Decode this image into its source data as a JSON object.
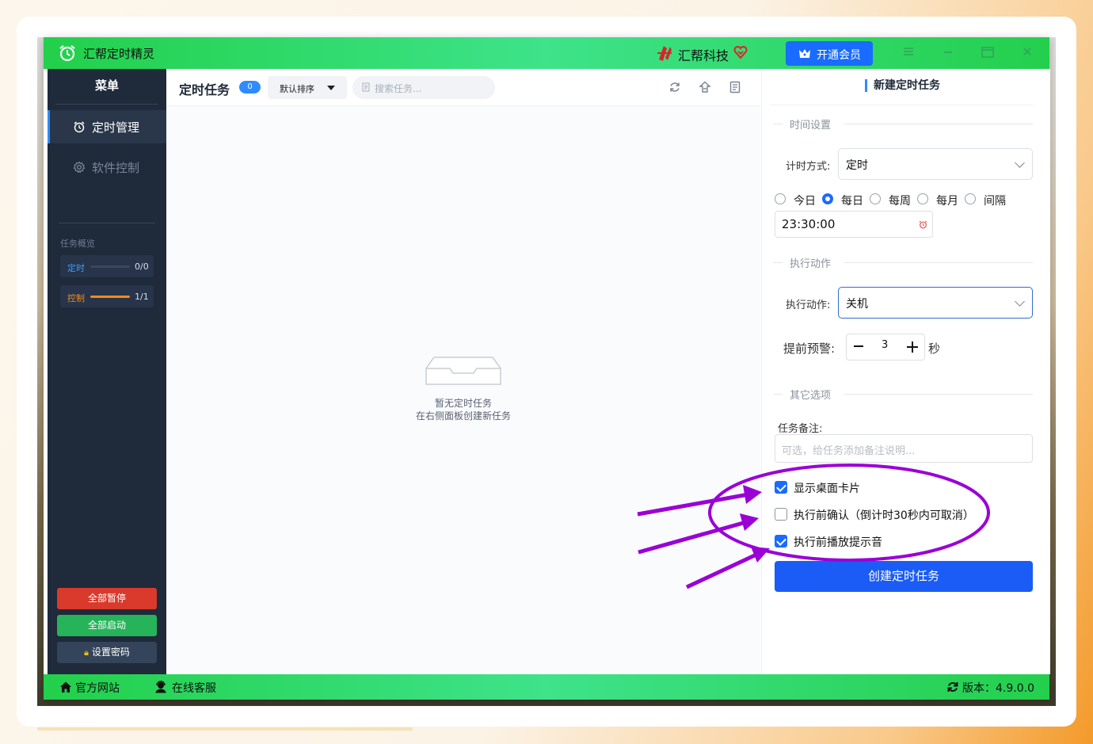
{
  "colors": {
    "titlebar_green": "#2ed760",
    "sidebar_bg": "#1f2a3a",
    "accent_blue": "#1a6bff",
    "pause_red": "#d93a2b",
    "start_green": "#27b35a",
    "annotation_purple": "#9a00d6"
  },
  "titlebar": {
    "app_title": "汇帮定时精灵",
    "brand": "汇帮科技",
    "vip_label": "开通会员",
    "icons": [
      "clock-logo-icon",
      "brand-logo-icon",
      "heart-icon",
      "crown-icon",
      "menu-icon",
      "minimize-icon",
      "maximize-icon",
      "close-icon"
    ]
  },
  "sidebar": {
    "menu_title": "菜单",
    "items": [
      {
        "label": "定时管理",
        "icon": "alarm-clock-icon",
        "active": true
      },
      {
        "label": "软件控制",
        "icon": "gear-icon",
        "active": false
      }
    ],
    "overview_label": "任务概览",
    "overview": [
      {
        "key": "定时",
        "value": "0/0",
        "fraction": 0,
        "color": "#3c9cff"
      },
      {
        "key": "控制",
        "value": "1/1",
        "fraction": 1,
        "color": "#f08a1c"
      }
    ],
    "buttons": {
      "pause_all": "全部暂停",
      "start_all": "全部启动",
      "set_password": "设置密码"
    }
  },
  "tasks": {
    "title": "定时任务",
    "count": "0",
    "sort_label": "默认排序",
    "search_placeholder": "搜索任务...",
    "empty_line1": "暂无定时任务",
    "empty_line2": "在右侧面板创建新任务"
  },
  "new_task": {
    "title": "新建定时任务",
    "time_section": "时间设置",
    "timing_mode_label": "计时方式:",
    "timing_mode_value": "定时",
    "radios": [
      {
        "label": "今日",
        "checked": false
      },
      {
        "label": "每日",
        "checked": true
      },
      {
        "label": "每周",
        "checked": false
      },
      {
        "label": "每月",
        "checked": false
      },
      {
        "label": "间隔",
        "checked": false
      }
    ],
    "time_value": "23:30:00",
    "action_section": "执行动作",
    "action_label": "执行动作:",
    "action_value": "关机",
    "warning_label": "提前预警:",
    "warning_value": "3",
    "warning_unit": "秒",
    "other_section": "其它选项",
    "note_label": "任务备注:",
    "note_placeholder": "可选，给任务添加备注说明...",
    "checkboxes": [
      {
        "label": "显示桌面卡片",
        "checked": true
      },
      {
        "label": "执行前确认（倒计时30秒内可取消）",
        "checked": false
      },
      {
        "label": "执行前播放提示音",
        "checked": true
      }
    ],
    "create_button": "创建定时任务"
  },
  "statusbar": {
    "website": "官方网站",
    "support": "在线客服",
    "version": "版本：4.9.0.0"
  }
}
